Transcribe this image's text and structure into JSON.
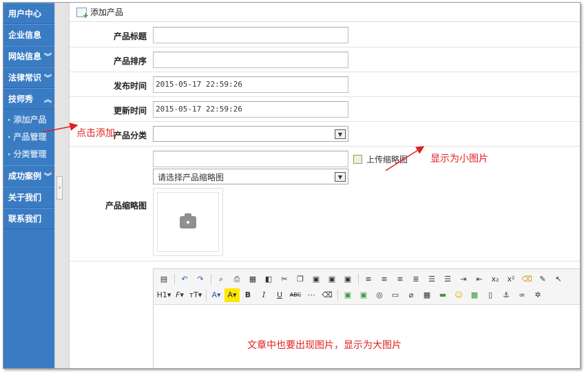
{
  "sidebar": {
    "items": [
      {
        "label": "用户中心"
      },
      {
        "label": "企业信息"
      },
      {
        "label": "网站信息"
      },
      {
        "label": "法律常识"
      },
      {
        "label": "技师秀"
      },
      {
        "label": "成功案例"
      },
      {
        "label": "关于我们"
      },
      {
        "label": "联系我们"
      }
    ],
    "submenu": [
      {
        "label": "添加产品"
      },
      {
        "label": "产品管理"
      },
      {
        "label": "分类管理"
      }
    ]
  },
  "page": {
    "title": "添加产品"
  },
  "form": {
    "title_label": "产品标题",
    "title_value": "",
    "sort_label": "产品排序",
    "sort_value": "",
    "publish_label": "发布时间",
    "publish_value": "2015-05-17 22:59:26",
    "update_label": "更新时间",
    "update_value": "2015-05-17 22:59:26",
    "category_label": "产品分类",
    "category_value": "",
    "thumb_label": "产品缩略图",
    "thumb_input_value": "",
    "upload_label": "上传缩略图",
    "thumb_select_value": "请选择产品缩略图"
  },
  "editor": {
    "toolbar_row2_labels": [
      "H1",
      "F",
      "тT",
      "A",
      "A",
      "B",
      "I",
      "U",
      "ABC"
    ],
    "content": "文章中也要出现图片，显示为大图片"
  },
  "annotations": {
    "click_add": "点击添加",
    "show_small": "显示为小图片"
  },
  "colors": {
    "sidebar": "#3a7cc3",
    "annotation": "#e02020"
  }
}
